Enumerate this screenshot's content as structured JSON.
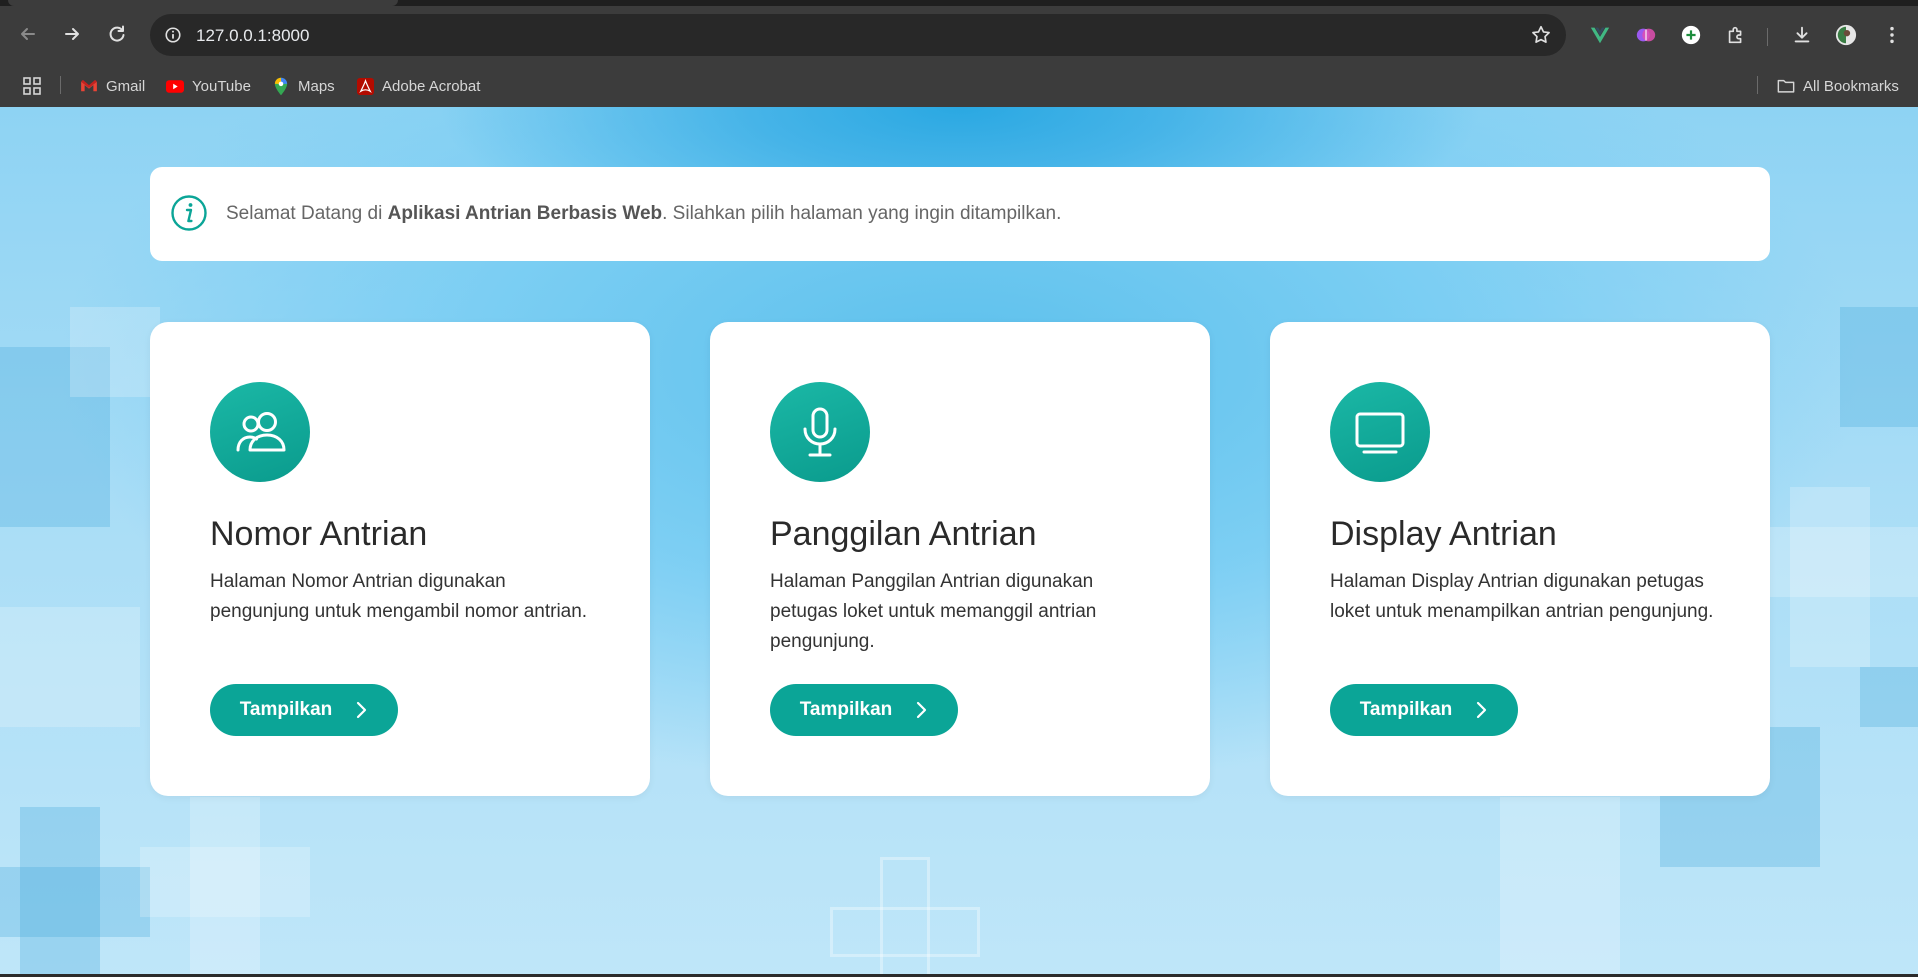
{
  "browser": {
    "url": "127.0.0.1:8000",
    "bookmarks": [
      {
        "label": "Gmail",
        "icon": "gmail-icon"
      },
      {
        "label": "YouTube",
        "icon": "youtube-icon"
      },
      {
        "label": "Maps",
        "icon": "maps-icon"
      },
      {
        "label": "Adobe Acrobat",
        "icon": "acrobat-icon"
      }
    ],
    "all_bookmarks_label": "All Bookmarks"
  },
  "info": {
    "prefix": "Selamat Datang di ",
    "app_name": "Aplikasi Antrian Berbasis Web",
    "suffix": ". Silahkan pilih halaman yang ingin ditampilkan."
  },
  "cards": [
    {
      "icon": "people-icon",
      "title": "Nomor Antrian",
      "desc": "Halaman Nomor Antrian digunakan pengunjung untuk mengambil nomor antrian.",
      "button": "Tampilkan"
    },
    {
      "icon": "microphone-icon",
      "title": "Panggilan Antrian",
      "desc": "Halaman Panggilan Antrian digunakan petugas loket untuk memanggil antrian pengunjung.",
      "button": "Tampilkan"
    },
    {
      "icon": "display-icon",
      "title": "Display Antrian",
      "desc": "Halaman Display Antrian digunakan petugas loket untuk menampilkan antrian pengunjung.",
      "button": "Tampilkan"
    }
  ],
  "colors": {
    "accent": "#0ba597",
    "browser_toolbar": "#3c3c3c",
    "omnibox": "#282828"
  }
}
